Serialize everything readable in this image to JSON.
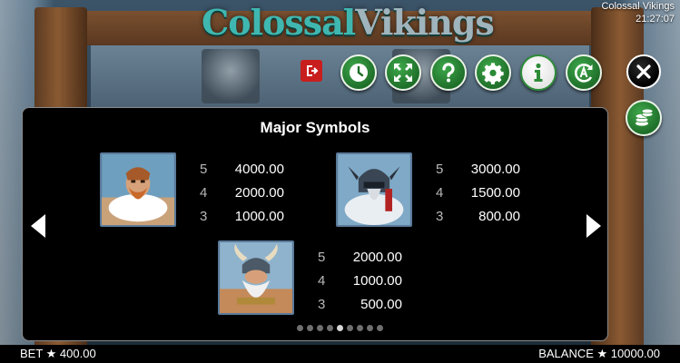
{
  "game_title": "Colossal Vikings",
  "clock": "21:27:07",
  "logo": {
    "part1": "Colossal",
    "part2": "Vikings"
  },
  "toolbar": {
    "buttons": [
      {
        "name": "exit-icon"
      },
      {
        "name": "clock-icon"
      },
      {
        "name": "fullscreen-icon"
      },
      {
        "name": "help-icon"
      },
      {
        "name": "settings-icon"
      },
      {
        "name": "info-icon"
      },
      {
        "name": "autoplay-icon"
      },
      {
        "name": "close-icon"
      },
      {
        "name": "coins-icon"
      }
    ]
  },
  "paytable": {
    "title": "Major Symbols",
    "symbols": [
      {
        "name": "bearded-viking",
        "pays": [
          {
            "count": "5",
            "value": "4000.00"
          },
          {
            "count": "4",
            "value": "2000.00"
          },
          {
            "count": "3",
            "value": "1000.00"
          }
        ]
      },
      {
        "name": "masked-viking",
        "pays": [
          {
            "count": "5",
            "value": "3000.00"
          },
          {
            "count": "4",
            "value": "1500.00"
          },
          {
            "count": "3",
            "value": "800.00"
          }
        ]
      },
      {
        "name": "horned-viking",
        "pays": [
          {
            "count": "5",
            "value": "2000.00"
          },
          {
            "count": "4",
            "value": "1000.00"
          },
          {
            "count": "3",
            "value": "500.00"
          }
        ]
      }
    ],
    "page_total": 9,
    "page_current": 5
  },
  "footer": {
    "bet_label": "BET ★ 400.00",
    "balance_label": "BALANCE ★ 10000.00"
  },
  "colors": {
    "button_green": "#2e8c39",
    "panel_bg": "#000000",
    "exit_red": "#c81e1e"
  }
}
